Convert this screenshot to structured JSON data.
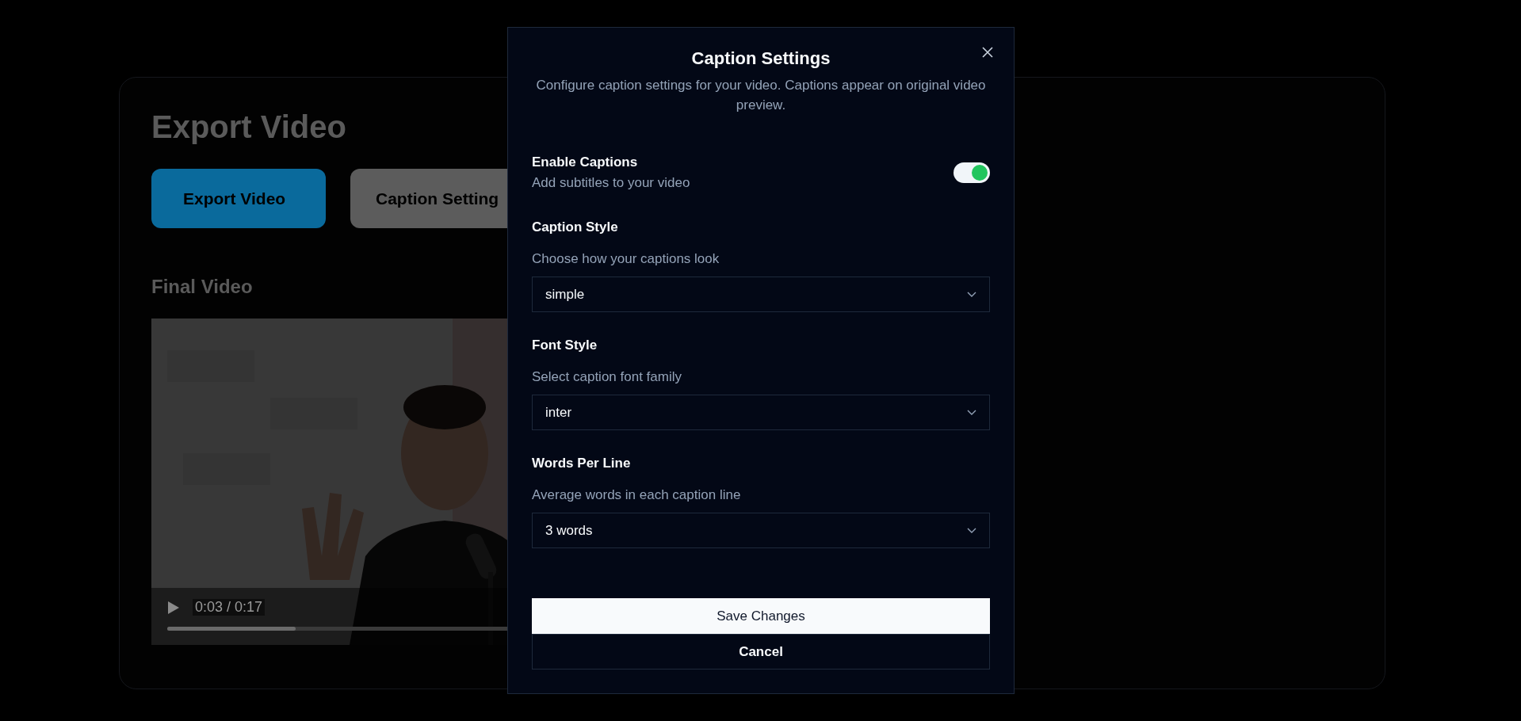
{
  "page": {
    "title": "Export Video",
    "tabs": [
      {
        "label": "Export Video",
        "selected": true
      },
      {
        "label": "Caption Setting",
        "selected": false
      }
    ],
    "section_title": "Final Video",
    "video": {
      "kind": "picture",
      "time": "0:03 / 0:17",
      "level": 0.3
    }
  },
  "dialog": {
    "title": "Caption Settings",
    "description": "Configure caption settings for your video. Captions appear on original video preview.",
    "toggle": {
      "label": "Enable Captions",
      "hint": "Add subtitles to your video",
      "on": true
    },
    "selects": [
      {
        "label": "Caption Style",
        "hint": "Choose how your captions look",
        "value": "simple"
      },
      {
        "label": "Font Style",
        "hint": "Select caption font family",
        "value": "inter"
      },
      {
        "label": "Words Per Line",
        "hint": "Average words in each caption line",
        "value": "3 words"
      }
    ],
    "buttons": [
      {
        "label": "Save Changes",
        "kind": "primary"
      },
      {
        "label": "Cancel",
        "kind": "secondary"
      }
    ]
  }
}
